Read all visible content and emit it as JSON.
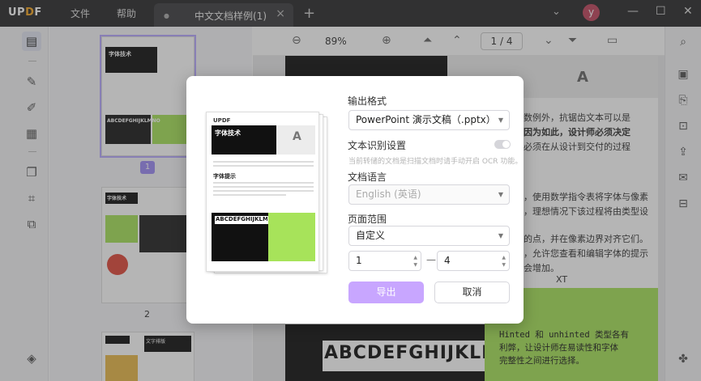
{
  "app": {
    "logo": "UPDF",
    "menu": [
      "文件",
      "帮助"
    ],
    "tab_title": "中文文档样例(1)",
    "avatar_letter": "y"
  },
  "toolbar": {
    "zoom": "89%",
    "page_indicator": "1 / 4"
  },
  "thumbnails": {
    "selected_page": "1",
    "second_page_label": "2"
  },
  "document": {
    "right_lines": [
      "数例外，抗锯齿文本可以是",
      "因为如此，设计师必须决定",
      "必须在从设计到交付的过程"
    ],
    "mid_lines": [
      "，使用数学指令表将字体与像素",
      "，理想情况下该过程将由类型设"
    ],
    "mid_lines2": [
      "的点，并在像素边界对齐它们。",
      "，允许您查看和编辑字体的提示",
      "会增加。"
    ],
    "xt": "XT",
    "green_text": [
      "Hinted 和 unhinted 类型各有",
      "利弊，让设计师在易读性和字体",
      "完整性之间进行选择。"
    ],
    "big_glyphs": "ABCDEFGHIJKLMNO",
    "thumb_title": "字体技术",
    "thumb_title_p2": "文字排版",
    "thumb_glyphs": "ABCDEFGHIJKLMNO"
  },
  "dialog": {
    "output_format_label": "输出格式",
    "output_format_value": "PowerPoint 演示文稿（.pptx）",
    "ocr_label": "文本识别设置",
    "ocr_hint": "当前转储的文档是扫描文档时请手动开启 OCR 功能。",
    "language_label": "文档语言",
    "language_value": "English (英语)",
    "page_range_label": "页面范围",
    "page_range_value": "自定义",
    "range_from": "1",
    "range_to": "4",
    "range_dash": "—",
    "export_button": "导出",
    "cancel_button": "取消",
    "preview_title": "字体技术",
    "preview_subtitle": "字体提示",
    "preview_glyphs": "ABCDEFGHIJKLMNO",
    "preview_logo": "UPDF"
  },
  "colors": {
    "accent": "#9d8cf5",
    "export_button": "#c8a6ff",
    "green": "#a7e35a",
    "titlebar": "#2b2b2d"
  }
}
